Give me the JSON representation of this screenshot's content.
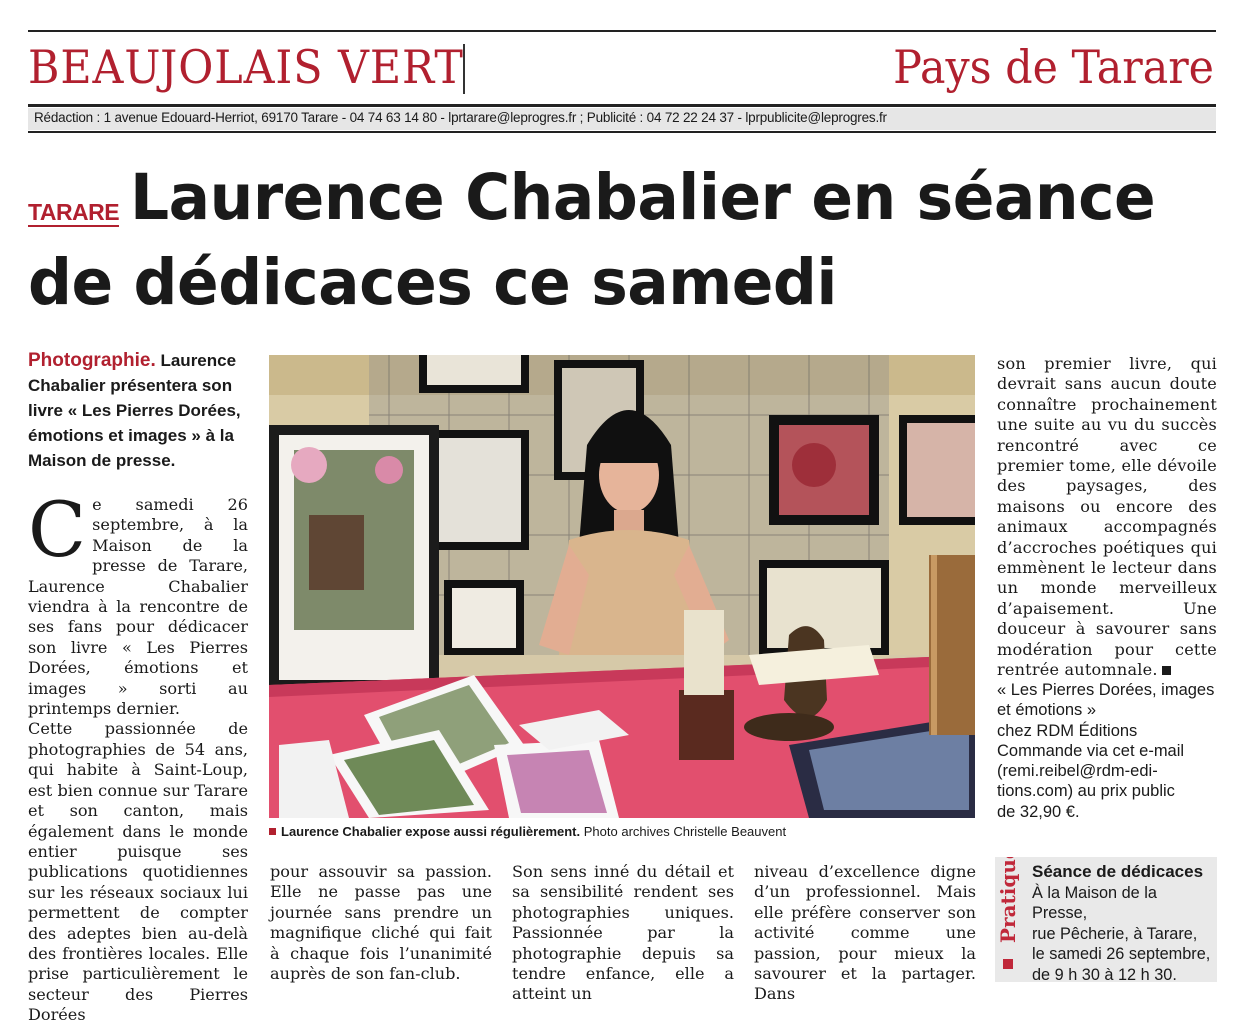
{
  "header": {
    "section_left": "BEAUJOLAIS VERT",
    "section_right": "Pays de Tarare",
    "contact": "Rédaction : 1 avenue Edouard-Herriot, 69170 Tarare - 04 74 63 14 80 - lprtarare@leprogres.fr ; Publicité : 04 72 22 24 37 - lprpublicite@leprogres.fr"
  },
  "article": {
    "kicker": "TARARE",
    "headline_line1": "Laurence Chabalier en séance",
    "headline_line2": "de dédicaces ce samedi",
    "chapo_kicker": "Photographie.",
    "chapo_text": "Laurence Chabalier présentera son livre « Les Pierres Dorées, émotions et images » à la Maison de presse.",
    "dropcap": "C",
    "col1_p1": "e samedi 26 septembre, à la Maison de la presse de Tarare, Laurence Chabalier viendra à la rencontre de ses fans pour dédicacer son livre « Les Pierres Dorées, émotions et images » sorti au printemps dernier.",
    "col1_p2": "Cette passionnée de photographies de 54 ans, qui habite à Saint-Loup, est bien connue sur Tarare et son canton, mais également dans le monde entier puisque ses publications quotidiennes sur les réseaux sociaux lui permettent de compter des adeptes bien au-delà des frontières locales. Elle prise particulièrement le secteur des Pierres Dorées",
    "col2": "pour assouvir sa passion. Elle ne passe pas une journée sans prendre un magnifique cliché qui fait à chaque fois l’unanimité auprès de son fan-club.",
    "col3": "Son sens inné du détail et sa sensibilité rendent ses photographies uniques. Passionnée par la photographie depuis sa tendre enfance, elle a atteint un",
    "col4": "niveau d’excellence digne d’un professionnel. Mais elle préfère conserver son activité comme une passion, pour mieux la savourer et la partager. Dans",
    "col5": "son premier livre, qui devrait sans aucun doute connaître prochainement une suite au vu du succès rencontré avec ce premier tome, elle dévoile des paysages, des maisons ou encore des animaux accompagnés d’accroches poétiques qui emmènent le lecteur dans un monde merveilleux d’apaisement. Une douceur à savourer sans modération pour cette rentrée automnale."
  },
  "book_info": {
    "line1": "« Les Pierres Dorées, images",
    "line2": "et émotions »",
    "line3": "chez RDM Éditions",
    "line4": "Commande via cet e-mail",
    "line5": "(remi.reibel@rdm-edi-",
    "line6": "tions.com) au prix public",
    "line7": "de 32,90 €."
  },
  "photo": {
    "caption_main": "Laurence Chabalier expose aussi régulièrement.",
    "caption_credit": "Photo archives Christelle Beauvent"
  },
  "pratique": {
    "label": "Pratique",
    "title": "Séance de dédicaces",
    "line1": "À la Maison de la Presse,",
    "line2": "rue Pêcherie, à Tarare,",
    "line3": "le samedi 26 septembre,",
    "line4": "de 9 h 30 à 12 h 30."
  },
  "colors": {
    "accent": "#b1202f",
    "text": "#1a1a1a",
    "band": "#e6e6e6"
  }
}
